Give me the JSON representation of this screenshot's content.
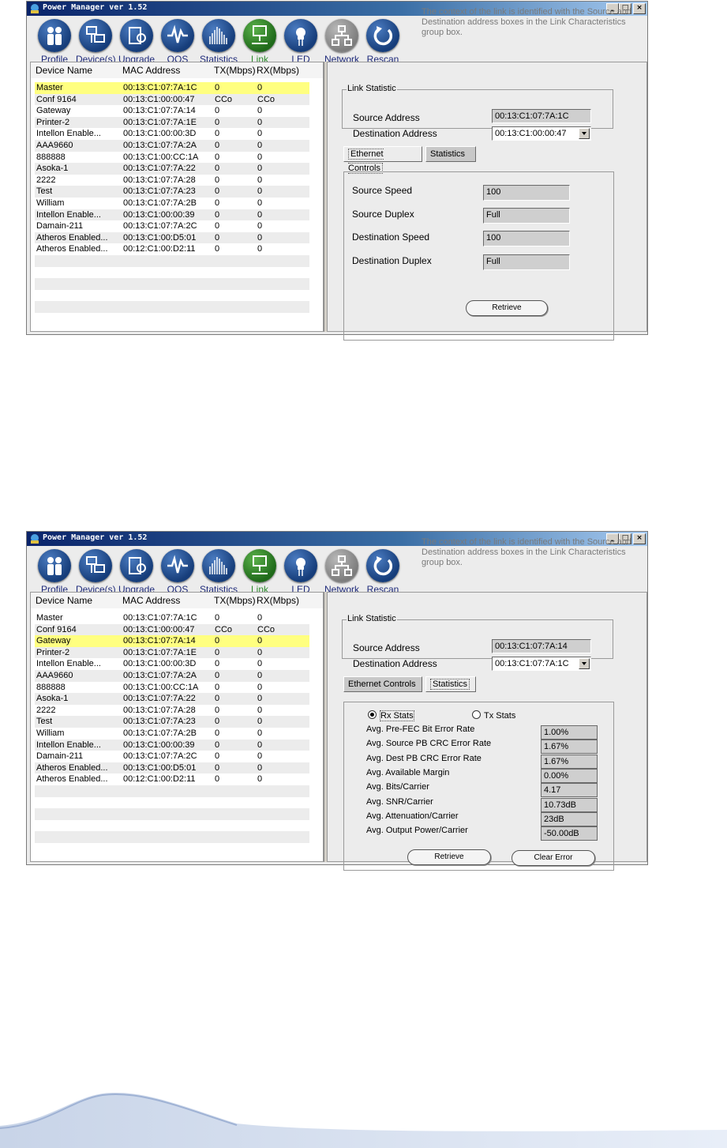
{
  "window": {
    "title": "Power Manager ver 1.52",
    "controls": [
      "_",
      "□",
      "×"
    ]
  },
  "toolbar": [
    {
      "label": "Profile",
      "icon": "profile-icon",
      "style": "blue"
    },
    {
      "label": "Device(s)",
      "icon": "devices-icon",
      "style": "blue"
    },
    {
      "label": "Upgrade",
      "icon": "upgrade-icon",
      "style": "blue"
    },
    {
      "label": "QOS",
      "icon": "qos-icon",
      "style": "blue"
    },
    {
      "label": "Statistics",
      "icon": "statistics-icon",
      "style": "blue"
    },
    {
      "label": "Link",
      "icon": "link-icon",
      "style": "green"
    },
    {
      "label": "LED",
      "icon": "led-icon",
      "style": "blue"
    },
    {
      "label": "Network",
      "icon": "network-icon",
      "style": "grey"
    },
    {
      "label": "Rescan",
      "icon": "rescan-icon",
      "style": "blue"
    }
  ],
  "hint": "The context of the link is identified with the Source and Destination address boxes in the Link Characteristics group box.",
  "table": {
    "headers": [
      "Device Name",
      "MAC Address",
      "TX(Mbps)",
      "RX(Mbps)"
    ],
    "rows": [
      [
        "Master",
        "00:13:C1:07:7A:1C",
        "0",
        "0"
      ],
      [
        "Conf 9164",
        "00:13:C1:00:00:47",
        "CCo",
        "CCo"
      ],
      [
        "Gateway",
        "00:13:C1:07:7A:14",
        "0",
        "0"
      ],
      [
        "Printer-2",
        "00:13:C1:07:7A:1E",
        "0",
        "0"
      ],
      [
        "Intellon Enable...",
        "00:13:C1:00:00:3D",
        "0",
        "0"
      ],
      [
        "AAA9660",
        "00:13:C1:07:7A:2A",
        "0",
        "0"
      ],
      [
        "888888",
        "00:13:C1:00:CC:1A",
        "0",
        "0"
      ],
      [
        "Asoka-1",
        "00:13:C1:07:7A:22",
        "0",
        "0"
      ],
      [
        "2222",
        "00:13:C1:07:7A:28",
        "0",
        "0"
      ],
      [
        "Test",
        "00:13:C1:07:7A:23",
        "0",
        "0"
      ],
      [
        "William",
        "00:13:C1:07:7A:2B",
        "0",
        "0"
      ],
      [
        "Intellon Enable...",
        "00:13:C1:00:00:39",
        "0",
        "0"
      ],
      [
        "Damain-211",
        "00:13:C1:07:7A:2C",
        "0",
        "0"
      ],
      [
        "Atheros Enabled...",
        "00:13:C1:00:D5:01",
        "0",
        "0"
      ],
      [
        "Atheros Enabled...",
        "00:12:C1:00:D2:11",
        "0",
        "0"
      ],
      [
        "",
        "",
        "",
        ""
      ],
      [
        "",
        "",
        "",
        ""
      ],
      [
        "",
        "",
        "",
        ""
      ],
      [
        "",
        "",
        "",
        ""
      ],
      [
        "",
        "",
        "",
        ""
      ],
      [
        "",
        "",
        "",
        ""
      ]
    ]
  },
  "link": {
    "group_title": "Link Statistic",
    "source_label": "Source Address",
    "dest_label": "Destination Address",
    "tabs": [
      "Ethernet Controls",
      "Statistics"
    ]
  },
  "shot1": {
    "selected_row": 0,
    "source_address": "00:13:C1:07:7A:1C",
    "dest_address": "00:13:C1:00:00:47",
    "active_tab": 0,
    "ethernet": [
      {
        "label": "Source Speed",
        "value": "100"
      },
      {
        "label": "Source Duplex",
        "value": "Full"
      },
      {
        "label": "Destination Speed",
        "value": "100"
      },
      {
        "label": "Destination Duplex",
        "value": "Full"
      }
    ],
    "retrieve": "Retrieve"
  },
  "shot2": {
    "selected_row": 2,
    "source_address": "00:13:C1:07:7A:14",
    "dest_address": "00:13:C1:07:7A:1C",
    "active_tab": 1,
    "radio_rx": "Rx Stats",
    "radio_tx": "Tx Stats",
    "stats": [
      {
        "label": "Avg. Pre-FEC Bit Error Rate",
        "value": "1.00%"
      },
      {
        "label": "Avg. Source PB CRC Error Rate",
        "value": "1.67%"
      },
      {
        "label": "Avg. Dest PB CRC Error Rate",
        "value": "1.67%"
      },
      {
        "label": "Avg. Available Margin",
        "value": "0.00%"
      },
      {
        "label": "Avg. Bits/Carrier",
        "value": "4.17"
      },
      {
        "label": "Avg. SNR/Carrier",
        "value": "10.73dB"
      },
      {
        "label": "Avg. Attenuation/Carrier",
        "value": "23dB"
      },
      {
        "label": "Avg. Output Power/Carrier",
        "value": "-50.00dB"
      }
    ],
    "retrieve": "Retrieve",
    "clear_error": "Clear Error"
  },
  "colors": {
    "selected_row": "#ffff80",
    "title_bar": "#0a246a",
    "toolbar_blue": "#1e2a7a",
    "link_green": "#2b8a2b"
  }
}
